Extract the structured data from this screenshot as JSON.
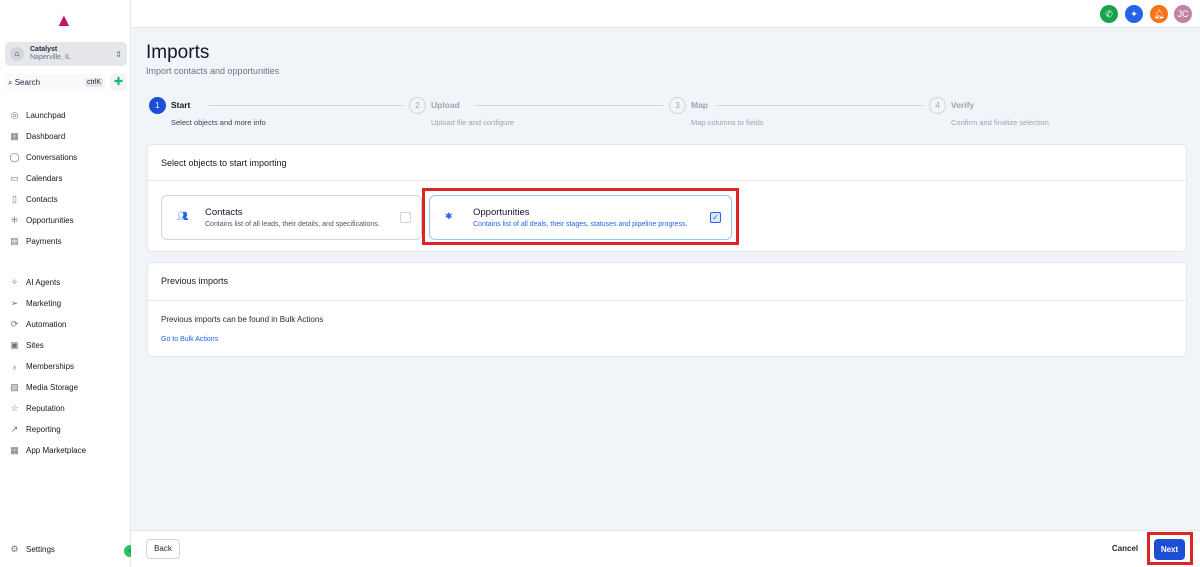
{
  "sidebar": {
    "account": {
      "name": "Catalyst",
      "location": "Naperville, IL"
    },
    "search": {
      "label": "Search",
      "shortcut": "ctrlK"
    },
    "items": [
      {
        "label": "Launchpad",
        "icon": "rocket-icon"
      },
      {
        "label": "Dashboard",
        "icon": "grid-icon"
      },
      {
        "label": "Conversations",
        "icon": "chat-icon"
      },
      {
        "label": "Calendars",
        "icon": "calendar-icon"
      },
      {
        "label": "Contacts",
        "icon": "contacts-icon"
      },
      {
        "label": "Opportunities",
        "icon": "opportunities-icon"
      },
      {
        "label": "Payments",
        "icon": "payments-icon"
      }
    ],
    "items2": [
      {
        "label": "AI Agents",
        "icon": "sparkle-icon"
      },
      {
        "label": "Marketing",
        "icon": "send-icon"
      },
      {
        "label": "Automation",
        "icon": "automation-icon"
      },
      {
        "label": "Sites",
        "icon": "sites-icon"
      },
      {
        "label": "Memberships",
        "icon": "membership-icon"
      },
      {
        "label": "Media Storage",
        "icon": "image-icon"
      },
      {
        "label": "Reputation",
        "icon": "star-icon"
      },
      {
        "label": "Reporting",
        "icon": "chart-icon"
      },
      {
        "label": "App Marketplace",
        "icon": "apps-icon"
      }
    ],
    "settings": "Settings"
  },
  "topbar": {
    "avatar": "JC"
  },
  "page": {
    "title": "Imports",
    "subtitle": "Import contacts and opportunities"
  },
  "steps": [
    {
      "num": "1",
      "label": "Start",
      "desc": "Select objects and more info",
      "active": true
    },
    {
      "num": "2",
      "label": "Upload",
      "desc": "Upload file and configure"
    },
    {
      "num": "3",
      "label": "Map",
      "desc": "Map columns to fields"
    },
    {
      "num": "4",
      "label": "Verify",
      "desc": "Confirm and finalize selection"
    }
  ],
  "select_card": {
    "title": "Select objects to start importing",
    "objects": [
      {
        "title": "Contacts",
        "desc": "Contains list of all leads, their details, and specifications.",
        "checked": false
      },
      {
        "title": "Opportunities",
        "desc": "Contains list of all deals, their stages, statuses and pipeline progress.",
        "checked": true
      }
    ]
  },
  "previous": {
    "title": "Previous imports",
    "text": "Previous imports can be found in Bulk Actions",
    "link": "Go to Bulk Actions"
  },
  "footer": {
    "back": "Back",
    "cancel": "Cancel",
    "next": "Next"
  }
}
